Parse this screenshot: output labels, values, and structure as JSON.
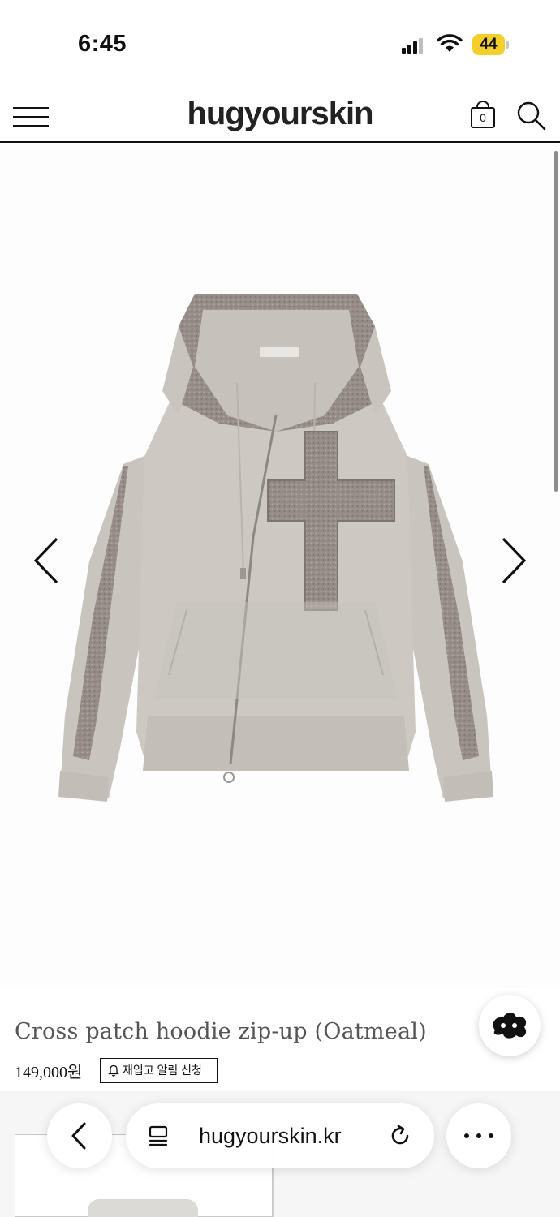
{
  "status_bar": {
    "time": "6:45",
    "battery_level": "44",
    "battery_color": "#f4cf2c"
  },
  "header": {
    "logo": "hugyourskin",
    "cart_count": "0",
    "menu_icon": "hamburger-menu-icon",
    "search_icon": "search-icon",
    "cart_icon": "shopping-bag-icon"
  },
  "gallery": {
    "prev_icon": "chevron-left-icon",
    "next_icon": "chevron-right-icon",
    "image_subject": "hoodie zip-up with cross patch"
  },
  "product": {
    "title": "Cross patch hoodie zip-up (Oatmeal)",
    "price": "149,000원",
    "restock_label": "재입고 알림 신청"
  },
  "browser": {
    "url": "hugyourskin.kr",
    "back_icon": "chevron-left-icon",
    "reader_icon": "reader-icon",
    "reload_icon": "reload-icon",
    "more_icon": "more-dots-icon"
  },
  "colors": {
    "text": "#111111",
    "title_gray": "#555555",
    "garment": "#c9c5be",
    "patch": "#8f8682"
  }
}
